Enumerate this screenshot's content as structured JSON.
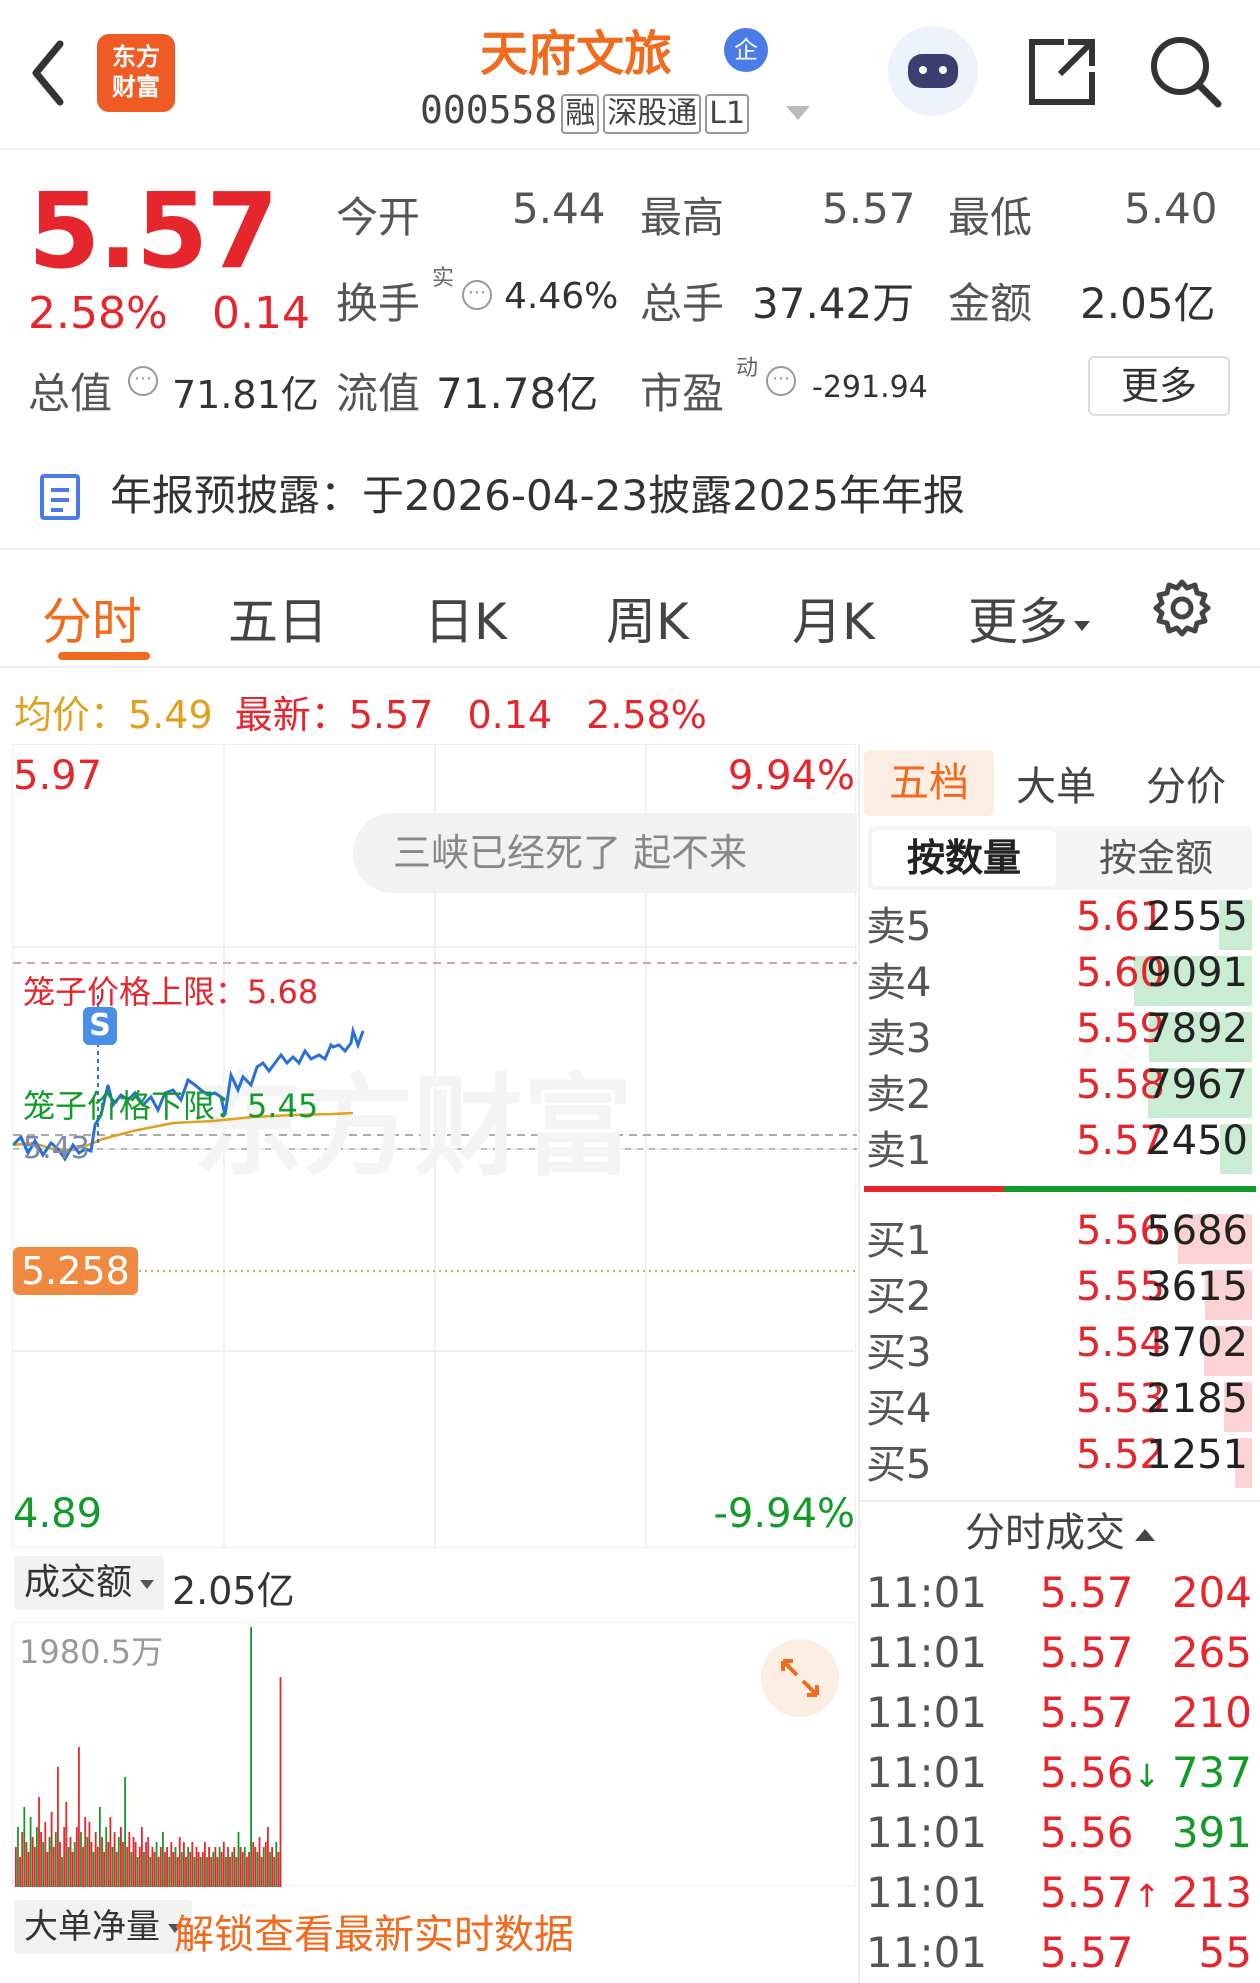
{
  "header": {
    "logo_text": "东方财富",
    "title": "天府文旅",
    "badge": "企",
    "code": "000558",
    "tags": [
      "融",
      "深股通",
      "L1"
    ]
  },
  "quote": {
    "price": "5.57",
    "change_pct": "2.58%",
    "change": "0.14",
    "open_label": "今开",
    "open": "5.44",
    "high_label": "最高",
    "high": "5.57",
    "low_label": "最低",
    "low": "5.40",
    "turnover_label": "换手",
    "turnover_sup": "实",
    "turnover": "4.46%",
    "volume_label": "总手",
    "volume": "37.42万",
    "amount_label": "金额",
    "amount": "2.05亿",
    "total_mv_label": "总值",
    "total_mv": "71.81亿",
    "float_mv_label": "流值",
    "float_mv": "71.78亿",
    "pe_label": "市盈",
    "pe_sup": "动",
    "pe": "-291.94",
    "more": "更多"
  },
  "notice": "年报预披露：于2026-04-23披露2025年年报",
  "tabs": [
    "分时",
    "五日",
    "日K",
    "周K",
    "月K",
    "更多"
  ],
  "avg_bar": {
    "avg_label": "均价：",
    "avg": "5.49",
    "last_label": "最新：",
    "last": "5.57",
    "chg": "0.14",
    "pct": "2.58%"
  },
  "chart": {
    "y_top": "5.97",
    "y_top_pct": "9.94%",
    "y_bot": "4.89",
    "y_bot_pct": "-9.94%",
    "comment": "三峡已经死了 起不来",
    "cage_upper": "笼子价格上限：5.68",
    "cage_lower": "笼子价格下限：5.45",
    "prev_close": "5.43",
    "marker_price": "5.258",
    "s_marker": "S",
    "watermark": "东方财富"
  },
  "volume": {
    "selector": "成交额",
    "total": "2.05亿",
    "max": "1980.5万",
    "bottom_selector": "大单净量",
    "unlock": "解锁查看最新实时数据"
  },
  "orderbook": {
    "tabs": [
      "五档",
      "大单",
      "分价"
    ],
    "subtabs": [
      "按数量",
      "按金额"
    ],
    "asks": [
      {
        "label": "卖5",
        "price": "5.61",
        "vol": "2555",
        "ratio": 0.28
      },
      {
        "label": "卖4",
        "price": "5.60",
        "vol": "9091",
        "ratio": 1.0
      },
      {
        "label": "卖3",
        "price": "5.59",
        "vol": "7892",
        "ratio": 0.87
      },
      {
        "label": "卖2",
        "price": "5.58",
        "vol": "7967",
        "ratio": 0.88
      },
      {
        "label": "卖1",
        "price": "5.57",
        "vol": "2450",
        "ratio": 0.27
      }
    ],
    "bids": [
      {
        "label": "买1",
        "price": "5.56",
        "vol": "5686",
        "ratio": 0.63
      },
      {
        "label": "买2",
        "price": "5.55",
        "vol": "3615",
        "ratio": 0.4
      },
      {
        "label": "买3",
        "price": "5.54",
        "vol": "3702",
        "ratio": 0.41
      },
      {
        "label": "买4",
        "price": "5.53",
        "vol": "2185",
        "ratio": 0.24
      },
      {
        "label": "买5",
        "price": "5.52",
        "vol": "1251",
        "ratio": 0.14
      }
    ],
    "trades_title": "分时成交",
    "trades": [
      {
        "t": "11:01",
        "p": "5.57",
        "arrow": "",
        "v": "204",
        "dir": "up"
      },
      {
        "t": "11:01",
        "p": "5.57",
        "arrow": "",
        "v": "265",
        "dir": "up"
      },
      {
        "t": "11:01",
        "p": "5.57",
        "arrow": "",
        "v": "210",
        "dir": "up"
      },
      {
        "t": "11:01",
        "p": "5.56",
        "arrow": "↓",
        "v": "737",
        "dir": "down"
      },
      {
        "t": "11:01",
        "p": "5.56",
        "arrow": "",
        "v": "391",
        "dir": "down"
      },
      {
        "t": "11:01",
        "p": "5.57",
        "arrow": "↑",
        "v": "213",
        "dir": "up"
      },
      {
        "t": "11:01",
        "p": "5.57",
        "arrow": "",
        "v": "55",
        "dir": "up"
      }
    ]
  },
  "colors": {
    "up": "#e5262c",
    "down": "#139b2a",
    "accent": "#f06b1e"
  }
}
